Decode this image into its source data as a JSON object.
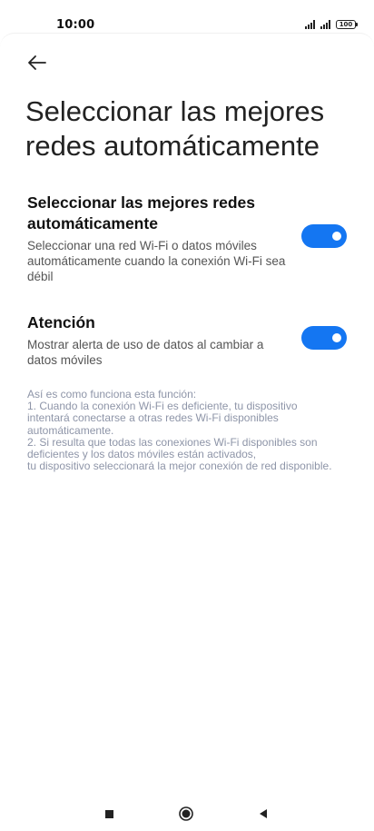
{
  "status_bar": {
    "time": "10:00",
    "battery_level": "100"
  },
  "header": {
    "title": "Seleccionar las mejores redes automáticamente"
  },
  "settings": [
    {
      "title": "Seleccionar las mejores redes automáticamente",
      "description": "Seleccionar una red Wi-Fi o datos móviles automáticamente cuando la conexión Wi-Fi sea débil",
      "enabled": true
    },
    {
      "title": "Atención",
      "description": "Mostrar alerta de uso de datos al cambiar a datos móviles",
      "enabled": true
    }
  ],
  "info": {
    "line1": "Así es como funciona esta función:",
    "line2": "1. Cuando la conexión Wi-Fi es deficiente, tu dispositivo intentará conectarse a otras redes Wi-Fi disponibles automáticamente.",
    "line3": "2. Si resulta que todas las conexiones Wi-Fi disponibles son deficientes y los datos móviles están activados,",
    "line4": "tu dispositivo seleccionará la mejor conexión de red disponible."
  },
  "colors": {
    "accent": "#1476f2",
    "info_text": "#8e95a8"
  },
  "icons": {
    "back": "arrow-left-icon",
    "nav_recent": "square-icon",
    "nav_home": "circle-icon",
    "nav_back": "triangle-left-icon"
  }
}
